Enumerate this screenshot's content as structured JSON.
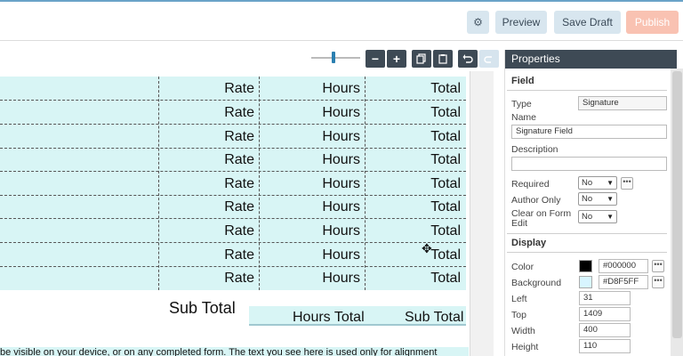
{
  "toolbar": {
    "preview_label": "Preview",
    "save_draft_label": "Save Draft",
    "publish_label": "Publish"
  },
  "grid": {
    "rows": [
      {
        "rate": "Rate",
        "hours": "Hours",
        "total": "Total"
      },
      {
        "rate": "Rate",
        "hours": "Hours",
        "total": "Total"
      },
      {
        "rate": "Rate",
        "hours": "Hours",
        "total": "Total"
      },
      {
        "rate": "Rate",
        "hours": "Hours",
        "total": "Total"
      },
      {
        "rate": "Rate",
        "hours": "Hours",
        "total": "Total"
      },
      {
        "rate": "Rate",
        "hours": "Hours",
        "total": "Total"
      },
      {
        "rate": "Rate",
        "hours": "Hours",
        "total": "Total"
      },
      {
        "rate": "Rate",
        "hours": "Hours",
        "total": "Total"
      },
      {
        "rate": "Rate",
        "hours": "Hours",
        "total": "Total"
      }
    ]
  },
  "subtotal": {
    "label": "Sub Total",
    "hours_total": "Hours Total",
    "sub_total": "Sub Total"
  },
  "disclaimer": "be visible on your device, or on any completed form. The text you see here is used only for alignment",
  "properties": {
    "header": "Properties",
    "field_section": "Field",
    "type_label": "Type",
    "type_value": "Signature",
    "name_label": "Name",
    "name_value": "Signature Field",
    "description_label": "Description",
    "description_value": "",
    "required_label": "Required",
    "required_value": "No",
    "author_only_label": "Author Only",
    "author_only_value": "No",
    "clear_label_1": "Clear on Form",
    "clear_label_2": "Edit",
    "clear_value": "No",
    "display_section": "Display",
    "color_label": "Color",
    "color_value": "#000000",
    "background_label": "Background",
    "background_value": "#D8F5FF",
    "left_label": "Left",
    "left_value": "31",
    "top_label": "Top",
    "top_value": "1409",
    "width_label": "Width",
    "width_value": "400",
    "height_label": "Height",
    "height_value": "110"
  },
  "colors": {
    "swatch_color": "#000000",
    "swatch_background": "#D8F5FF",
    "header_bg": "#3e4a55",
    "grid_bg": "#d8f5f5",
    "publish_bg": "#f9c2b2"
  },
  "icons": {
    "gear": "gear-icon",
    "minus": "zoom-out-icon",
    "plus": "zoom-in-icon",
    "copy": "copy-icon",
    "paste": "paste-icon",
    "undo": "undo-icon",
    "redo": "redo-icon",
    "move": "move-icon"
  }
}
